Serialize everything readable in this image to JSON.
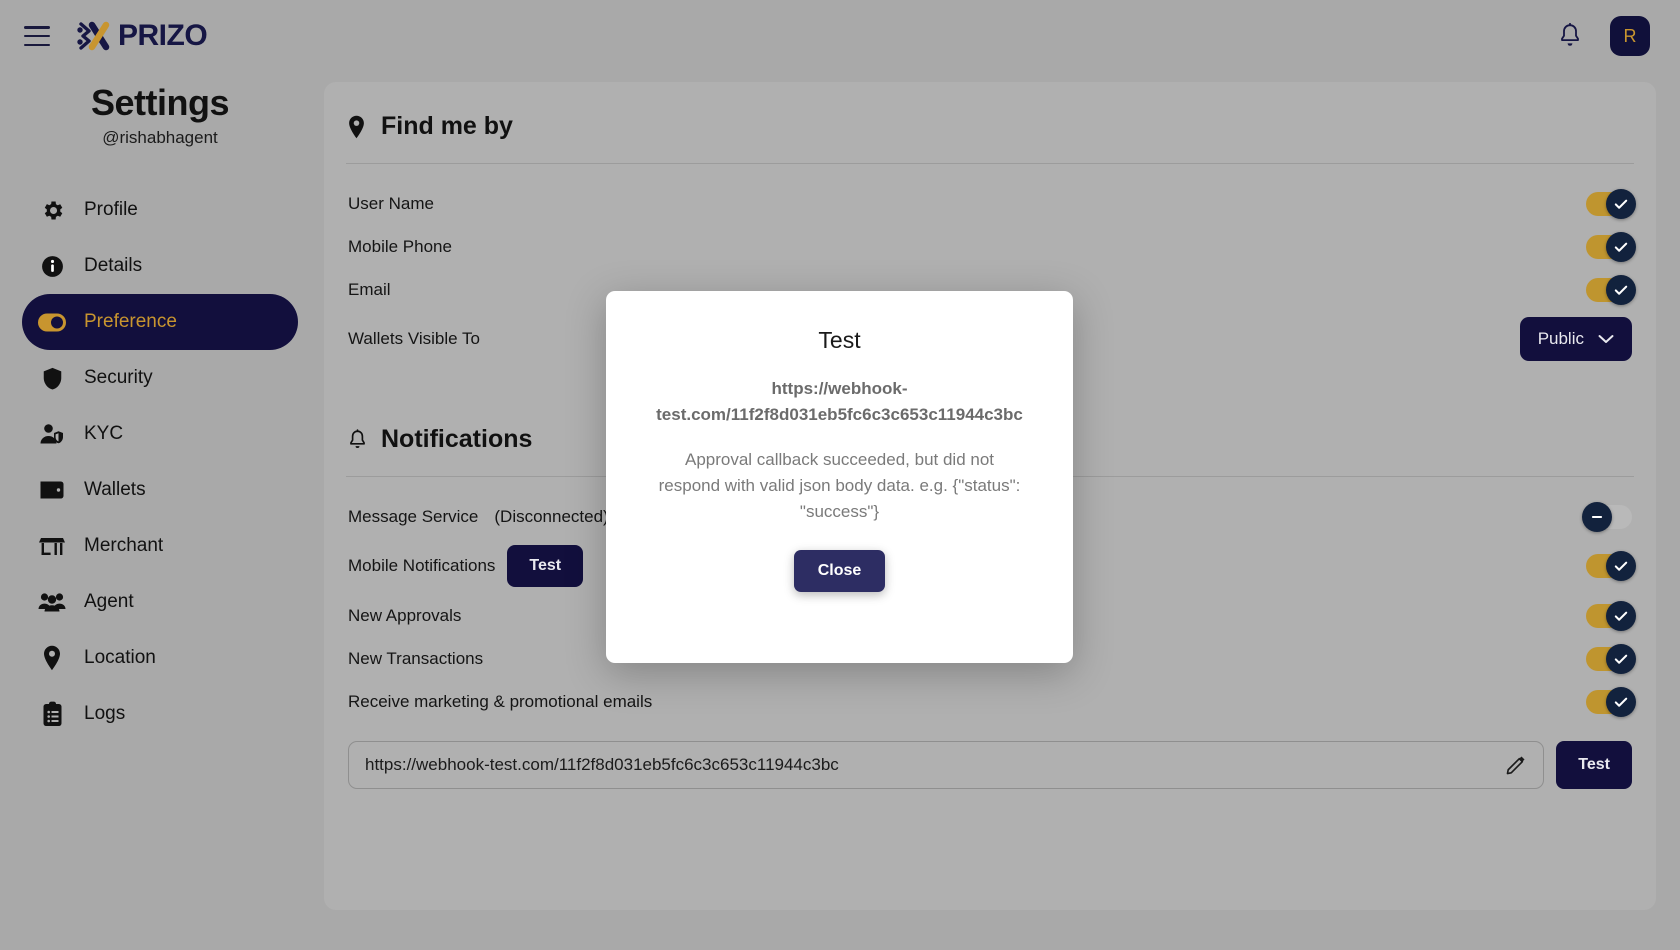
{
  "topbar": {
    "menu_icon": "hamburger-icon",
    "logo_text": "PRIZO",
    "bell_icon": "bell-icon",
    "avatar_initial": "R"
  },
  "sidebar": {
    "title": "Settings",
    "handle": "@rishabhagent",
    "items": [
      {
        "label": "Profile",
        "icon": "gear-icon",
        "active": false
      },
      {
        "label": "Details",
        "icon": "info-icon",
        "active": false
      },
      {
        "label": "Preference",
        "icon": "toggle-icon",
        "active": true
      },
      {
        "label": "Security",
        "icon": "shield-icon",
        "active": false
      },
      {
        "label": "KYC",
        "icon": "user-shield-icon",
        "active": false
      },
      {
        "label": "Wallets",
        "icon": "wallet-icon",
        "active": false
      },
      {
        "label": "Merchant",
        "icon": "store-icon",
        "active": false
      },
      {
        "label": "Agent",
        "icon": "people-icon",
        "active": false
      },
      {
        "label": "Location",
        "icon": "pin-icon",
        "active": false
      },
      {
        "label": "Logs",
        "icon": "clipboard-icon",
        "active": false
      }
    ]
  },
  "find_me_by": {
    "heading": "Find me by",
    "heading_icon": "pin-icon",
    "rows": [
      {
        "label": "User Name",
        "control": "toggle",
        "state": "on"
      },
      {
        "label": "Mobile Phone",
        "control": "toggle",
        "state": "on"
      },
      {
        "label": "Email",
        "control": "toggle",
        "state": "on"
      }
    ],
    "wallets_visible": {
      "label": "Wallets Visible To",
      "value": "Public",
      "chevron_icon": "chevron-down-icon"
    }
  },
  "notifications": {
    "heading": "Notifications",
    "heading_icon": "bell-icon",
    "rows": [
      {
        "label": "Message Service",
        "sub": "(Disconnected)",
        "button": null,
        "control": "toggle",
        "state": "off"
      },
      {
        "label": "Mobile Notifications",
        "sub": "",
        "button": "Test",
        "control": "toggle",
        "state": "on"
      },
      {
        "label": "New Approvals",
        "sub": "",
        "button": null,
        "control": "toggle",
        "state": "on"
      },
      {
        "label": "New Transactions",
        "sub": "",
        "button": null,
        "control": "toggle",
        "state": "on"
      },
      {
        "label": "Receive marketing & promotional emails",
        "sub": "",
        "button": null,
        "control": "toggle",
        "state": "on"
      }
    ],
    "webhook": {
      "value": "https://webhook-test.com/11f2f8d031eb5fc6c3c653c11944c3bc",
      "placeholder": "https://webhook-test.com/11f2f8d031eb5fc6c3c653c11944c3bc",
      "edit_icon": "pencil-icon",
      "test_label": "Test"
    }
  },
  "modal": {
    "title": "Test",
    "url": "https://webhook-test.com/11f2f8d031eb5fc6c3c653c11944c3bc",
    "message": "Approval callback succeeded, but did not respond with valid json body data. e.g. {\"status\": \"success\"}",
    "close_label": "Close"
  },
  "colors": {
    "navy": "#120f3d",
    "gold": "#c8952f",
    "toggle_knob": "#12223d",
    "toggle_off_track": "#b9b9b9",
    "close_button": "#2d2d63"
  }
}
